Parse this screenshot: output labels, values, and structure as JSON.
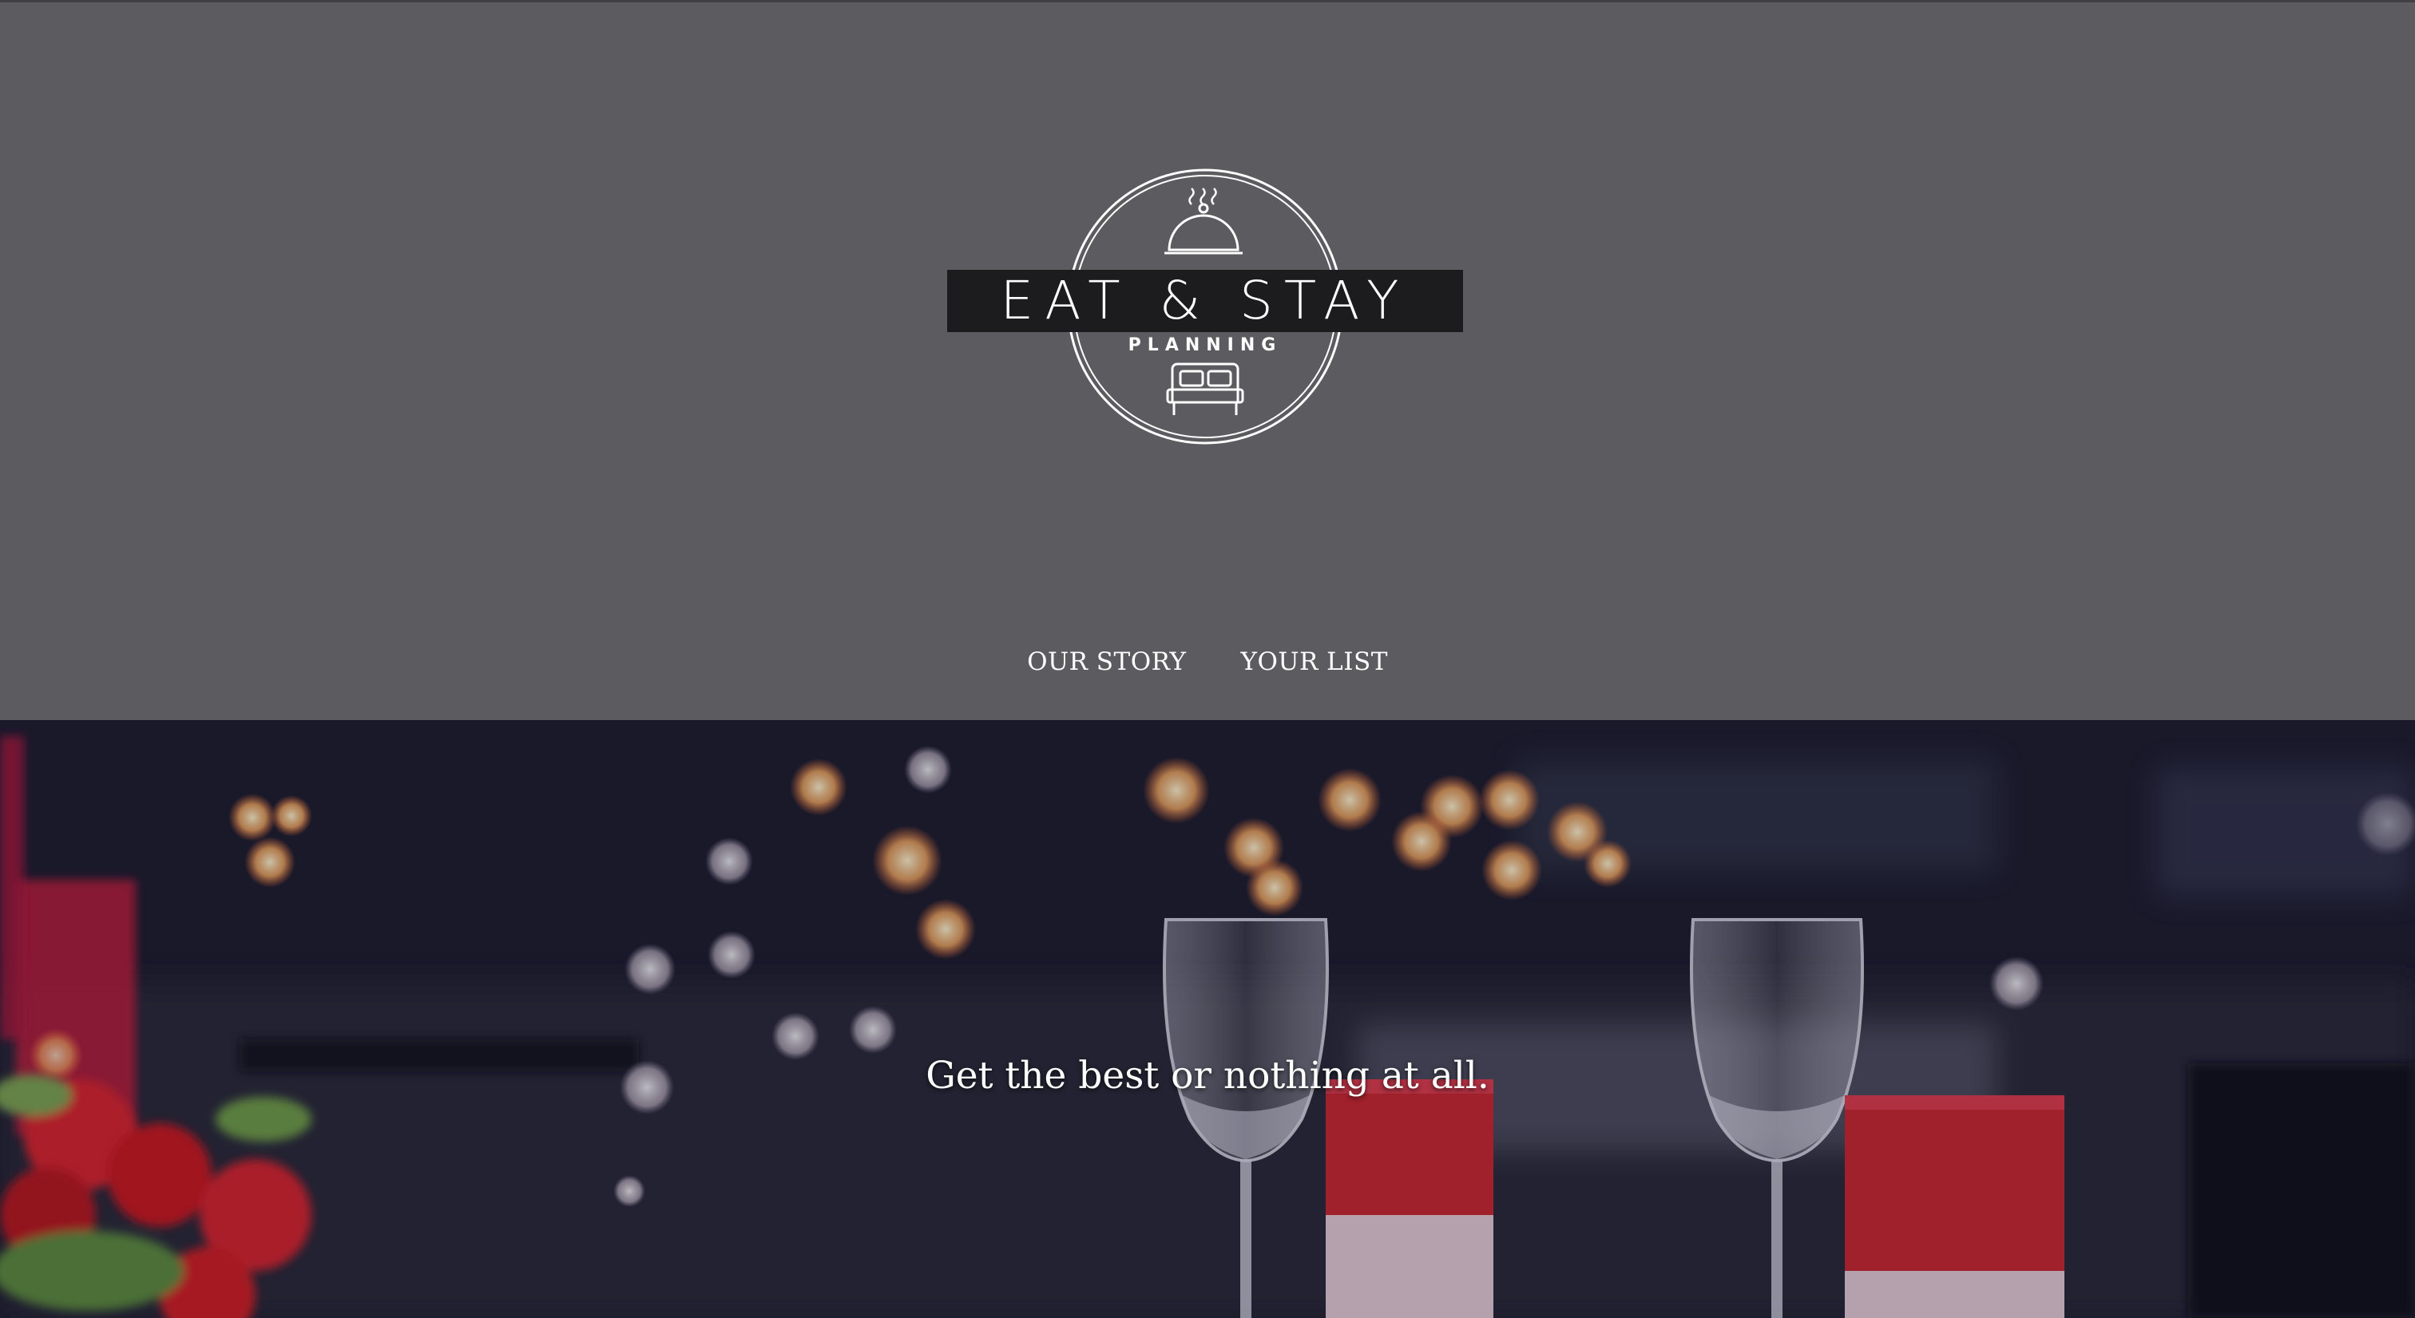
{
  "logo": {
    "title": "EAT & STAY",
    "subtitle": "PLANNING"
  },
  "nav": {
    "items": [
      {
        "label": "OUR STORY"
      },
      {
        "label": "YOUR LIST"
      }
    ]
  },
  "hero": {
    "tagline": "Get the best or nothing at all."
  },
  "colors": {
    "header_bg": "#5b5b60",
    "logo_band": "#1c1c1f",
    "text": "#ffffff",
    "accent_red": "#c8242e"
  }
}
